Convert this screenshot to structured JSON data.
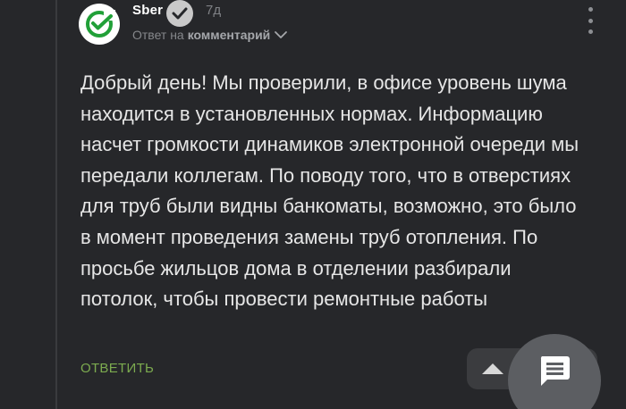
{
  "comment": {
    "author": "Sber",
    "time": "7д",
    "reply_to_prefix": "Ответ на",
    "reply_to_link": "комментарий",
    "text": "Добрый день! Мы проверили, в офисе уровень шума находится в установленных нормах. Информацию насчет громкости динамиков электронной очереди мы передали коллегам. По поводу того, что в отверстиях для труб были видны банкоматы, возможно, это было в момент проведения замены труб отопления. По просьбе жильцов дома в отделении разбирали потолок, чтобы провести ремонтные работы",
    "reply_button": "ОТВЕТИТЬ"
  },
  "icons": {
    "avatar": "sber-logo-icon",
    "verified": "verified-check-icon",
    "reply_dropdown": "chevron-down-icon",
    "more": "more-vertical-icon",
    "scroll_top": "chevron-up-icon",
    "fab": "comment-icon"
  },
  "colors": {
    "background": "#26272a",
    "text": "#e6e6e6",
    "accent_green": "#7cab4f",
    "muted": "#85878b"
  }
}
